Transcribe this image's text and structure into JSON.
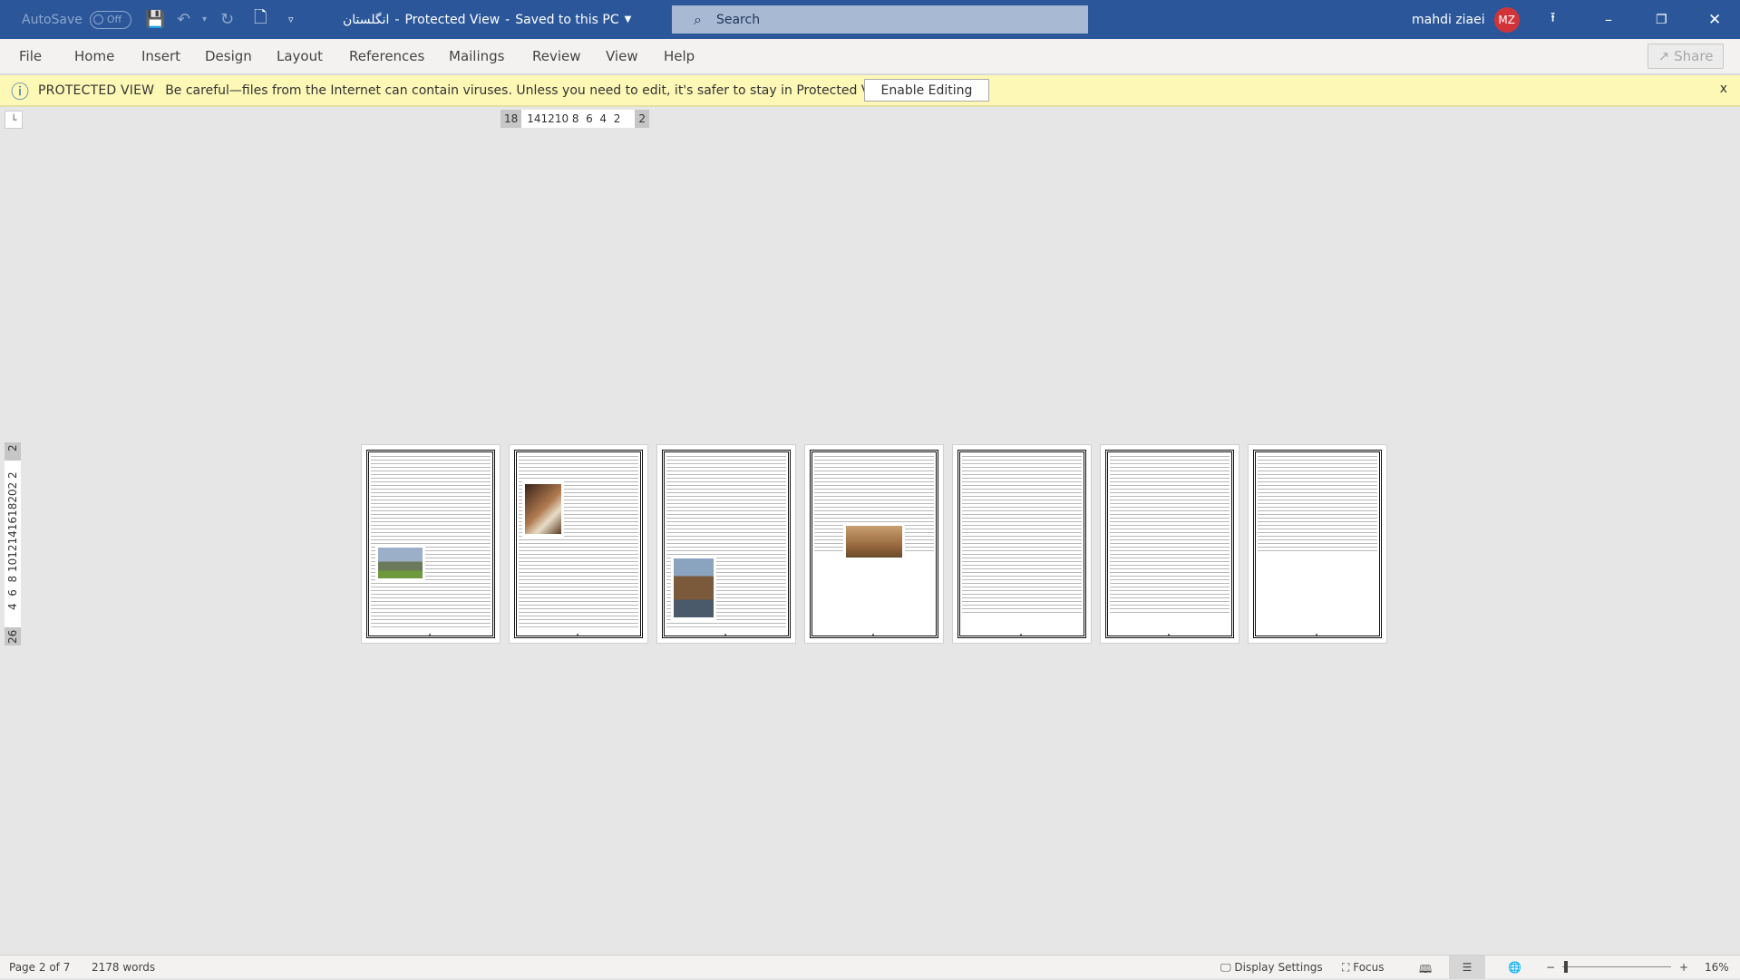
{
  "titlebar": {
    "autosave_label": "AutoSave",
    "autosave_state": "Off",
    "doc_title": "انگلستان",
    "mode": "Protected View",
    "save_state": "Saved to this PC",
    "search_placeholder": "Search",
    "user_name": "mahdi ziaei",
    "user_initials": "MZ",
    "accent": "#2b579a",
    "avatar_color": "#d13438"
  },
  "ribbon": {
    "tabs": [
      "File",
      "Home",
      "Insert",
      "Design",
      "Layout",
      "References",
      "Mailings",
      "Review",
      "View",
      "Help"
    ],
    "share_label": "Share"
  },
  "protected": {
    "title": "PROTECTED VIEW",
    "message": "Be careful—files from the Internet can contain viruses. Unless you need to edit, it's safer to stay in Protected View.",
    "enable_label": "Enable Editing",
    "close_label": "x"
  },
  "ruler": {
    "horizontal_left": "18",
    "horizontal_ticks": "141210 8  6  4  2",
    "horizontal_right": "2",
    "vertical_top": "2",
    "vertical_ticks": "4  6  8 1012141618202 2",
    "vertical_bottom": "26"
  },
  "pages": {
    "count": 7
  },
  "status": {
    "page": "Page 2 of 7",
    "words": "2178 words",
    "display_settings": "Display Settings",
    "focus": "Focus",
    "zoom_minus": "−",
    "zoom_plus": "+",
    "zoom_level": "16%"
  }
}
